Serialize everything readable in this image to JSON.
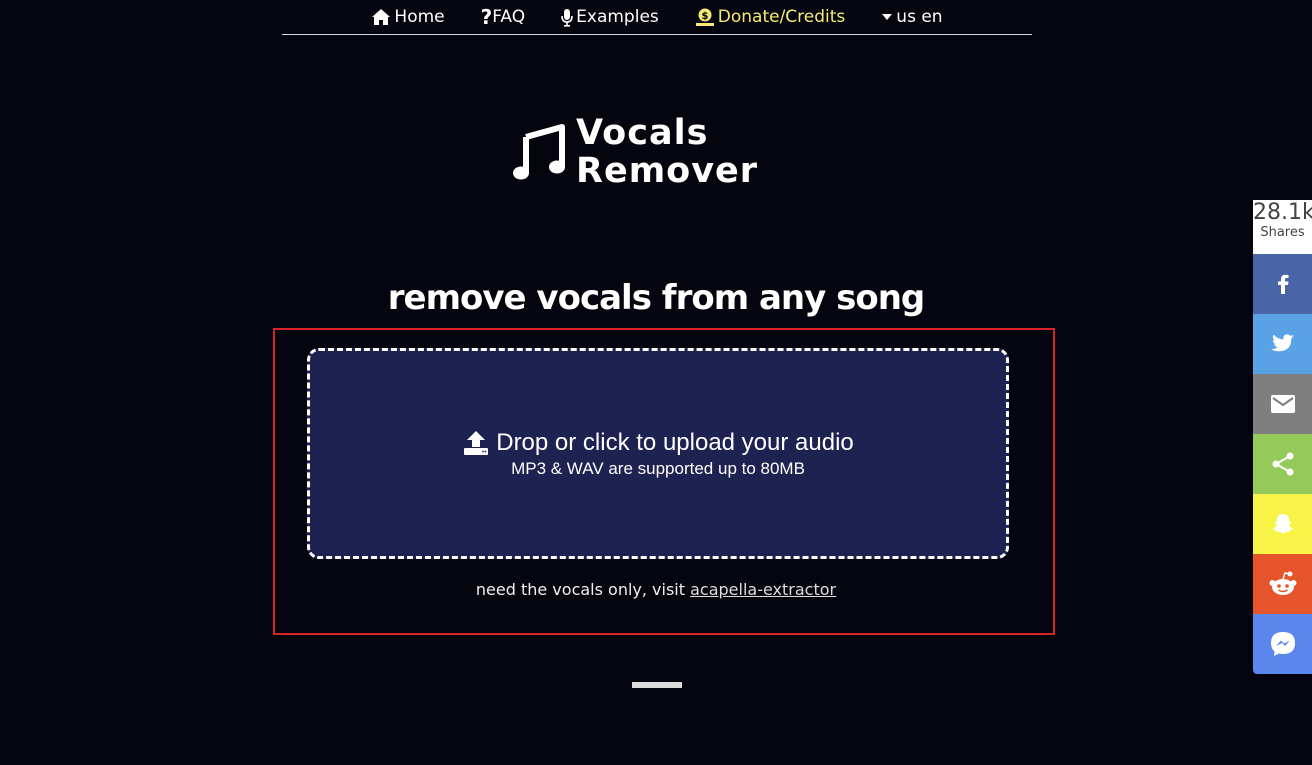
{
  "nav": {
    "items": [
      {
        "label": "Home",
        "icon": "home-icon"
      },
      {
        "label": "FAQ",
        "icon": "question-icon"
      },
      {
        "label": "Examples",
        "icon": "microphone-icon"
      },
      {
        "label": "Donate/Credits",
        "icon": "money-icon",
        "color": "#f5ea72"
      },
      {
        "label": "us en",
        "icon": "caret-down-icon"
      }
    ]
  },
  "logo": {
    "line1": "Vocals",
    "line2": "Remover",
    "icon": "music-note-icon"
  },
  "headline": "remove vocals from any song",
  "upload": {
    "title": "Drop or click to upload your audio",
    "subtitle": "MP3 & WAV are supported up to 80MB",
    "icon": "upload-icon",
    "background": "#1e2250",
    "highlight_color": "#d8232a"
  },
  "vocals_only": {
    "text": "need the vocals only, visit ",
    "link": "acapella-extractor"
  },
  "share": {
    "count": "28.1k",
    "label": "Shares",
    "buttons": [
      {
        "name": "facebook",
        "color": "#4a64a8"
      },
      {
        "name": "twitter",
        "color": "#5aa2e6"
      },
      {
        "name": "email",
        "color": "#7f7f7f"
      },
      {
        "name": "share",
        "color": "#95c95a"
      },
      {
        "name": "snapchat",
        "color": "#f7f447"
      },
      {
        "name": "reddit",
        "color": "#e5542a"
      },
      {
        "name": "messenger",
        "color": "#5b86ec"
      }
    ]
  }
}
